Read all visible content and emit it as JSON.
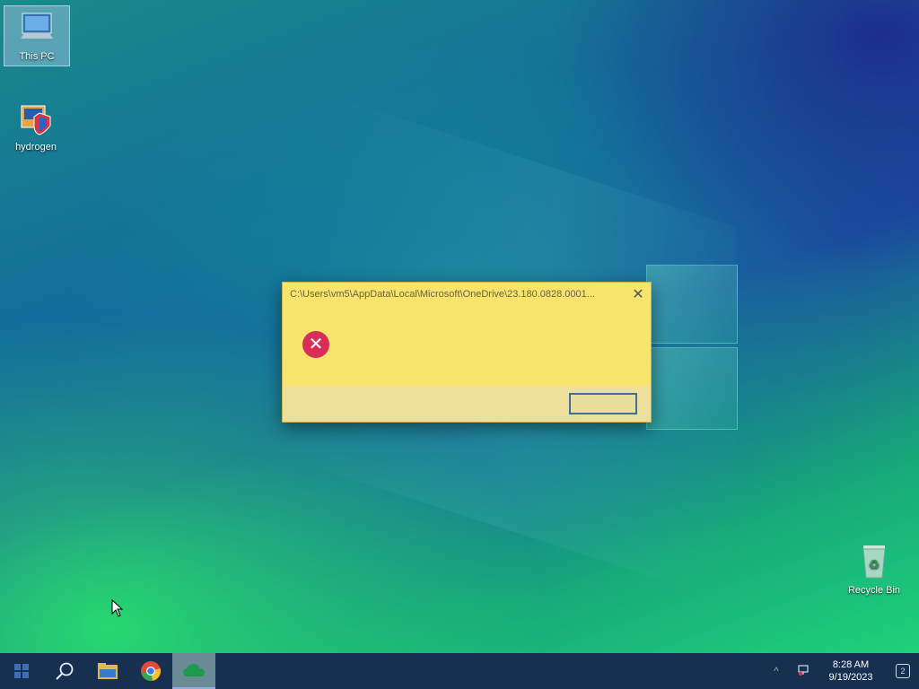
{
  "desktop": {
    "icons": [
      {
        "name": "this-pc",
        "label": "This PC",
        "icon": "computer-icon"
      },
      {
        "name": "hydrogen",
        "label": "hydrogen",
        "icon": "shield-app-icon"
      },
      {
        "name": "recycle-bin",
        "label": "Recycle Bin",
        "icon": "recycle-bin-icon"
      }
    ]
  },
  "dialog": {
    "title": "C:\\Users\\vm5\\AppData\\Local\\Microsoft\\OneDrive\\23.180.0828.0001...",
    "close_glyph": "✕",
    "icon": "error-icon",
    "error_glyph": "✕",
    "message": "",
    "ok_label": ""
  },
  "taskbar": {
    "items": [
      {
        "name": "start",
        "icon": "start-icon"
      },
      {
        "name": "search",
        "icon": "search-icon"
      },
      {
        "name": "file-explorer",
        "icon": "folder-icon"
      },
      {
        "name": "chrome",
        "icon": "chrome-icon"
      },
      {
        "name": "onedrive",
        "icon": "cloud-icon",
        "active": true
      }
    ],
    "tray": {
      "chevron": "^",
      "time": "8:28 AM",
      "date": "9/19/2023"
    }
  },
  "colors": {
    "dialog_bg": "#f6e46c",
    "error_red": "#d92e5a",
    "taskbar_bg": "#17304f"
  }
}
